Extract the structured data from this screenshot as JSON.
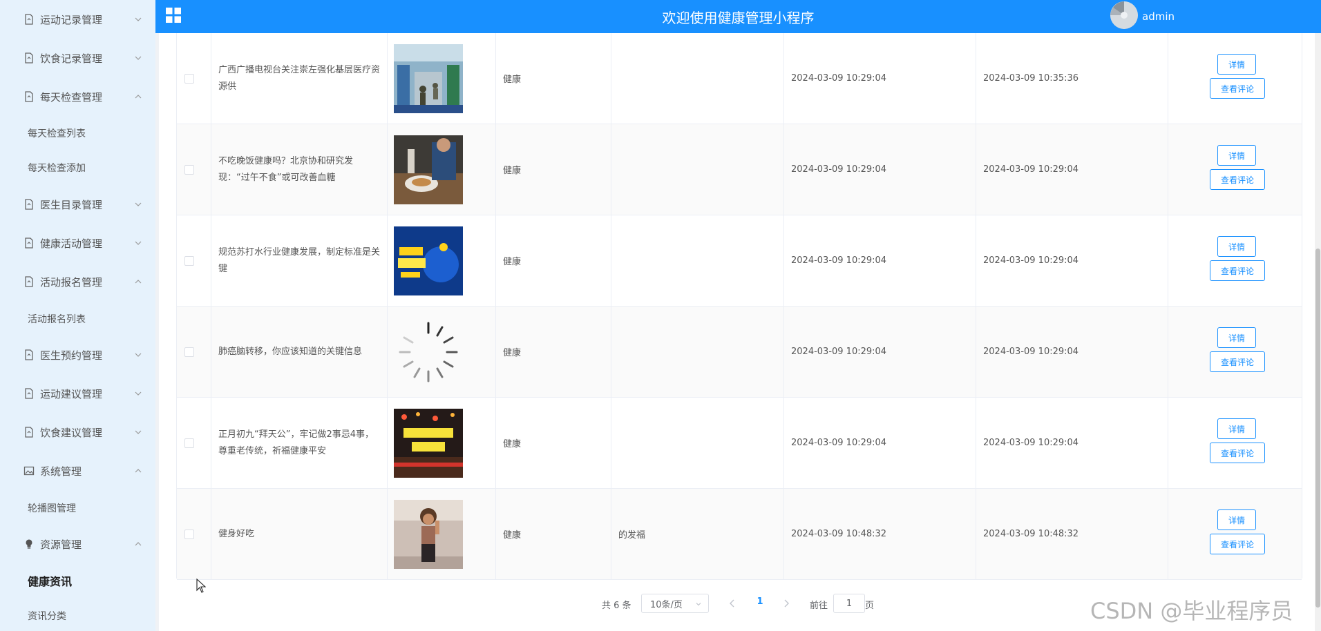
{
  "header": {
    "title": "欢迎使用健康管理小程序",
    "username": "admin"
  },
  "sidebar": {
    "items": [
      {
        "label": "运动记录管理",
        "icon": "document-icon",
        "expanded": false
      },
      {
        "label": "饮食记录管理",
        "icon": "document-icon",
        "expanded": false
      },
      {
        "label": "每天检查管理",
        "icon": "document-icon",
        "expanded": true
      },
      {
        "label": "每天检查列表",
        "sub": true
      },
      {
        "label": "每天检查添加",
        "sub": true
      },
      {
        "label": "医生目录管理",
        "icon": "document-icon",
        "expanded": false
      },
      {
        "label": "健康活动管理",
        "icon": "document-icon",
        "expanded": false
      },
      {
        "label": "活动报名管理",
        "icon": "document-icon",
        "expanded": true
      },
      {
        "label": "活动报名列表",
        "sub": true
      },
      {
        "label": "医生预约管理",
        "icon": "document-icon",
        "expanded": false
      },
      {
        "label": "运动建议管理",
        "icon": "document-icon",
        "expanded": false
      },
      {
        "label": "饮食建议管理",
        "icon": "document-icon",
        "expanded": false
      },
      {
        "label": "系统管理",
        "icon": "picture-icon",
        "expanded": true
      },
      {
        "label": "轮播图管理",
        "sub": true
      },
      {
        "label": "资源管理",
        "icon": "bulb-icon",
        "expanded": true
      },
      {
        "label": "健康资讯",
        "sub": true,
        "active": true
      },
      {
        "label": "资讯分类",
        "sub": true
      }
    ]
  },
  "table": {
    "rows": [
      {
        "title": "广西广播电视台关注崇左强化基层医疗资源供",
        "category": "健康",
        "extra": "",
        "created": "2024-03-09 10:29:04",
        "updated": "2024-03-09 10:35:36",
        "image": "hospital-photo"
      },
      {
        "title": "不吃晚饭健康吗？北京协和研究发现：“过午不食”或可改善血糖",
        "category": "健康",
        "extra": "",
        "created": "2024-03-09 10:29:04",
        "updated": "2024-03-09 10:29:04",
        "image": "dinner-photo"
      },
      {
        "title": "规范苏打水行业健康发展，制定标准是关键",
        "category": "健康",
        "extra": "",
        "created": "2024-03-09 10:29:04",
        "updated": "2024-03-09 10:29:04",
        "image": "poster-photo"
      },
      {
        "title": "肺癌脑转移，你应该知道的关键信息",
        "category": "健康",
        "extra": "",
        "created": "2024-03-09 10:29:04",
        "updated": "2024-03-09 10:29:04",
        "image": "loading-spinner"
      },
      {
        "title": "正月初九“拜天公”，牢记做2事忌4事，尊重老传统，祈福健康平安",
        "category": "健康",
        "extra": "",
        "created": "2024-03-09 10:29:04",
        "updated": "2024-03-09 10:29:04",
        "image": "festival-photo"
      },
      {
        "title": "健身好吃",
        "category": "健康",
        "extra": "的发福",
        "created": "2024-03-09 10:48:32",
        "updated": "2024-03-09 10:48:32",
        "image": "fitness-photo"
      }
    ],
    "detail_label": "详情",
    "comment_label": "查看评论"
  },
  "pagination": {
    "total_text": "共 6 条",
    "page_size": "10条/页",
    "current_page": "1",
    "goto_label": "前往",
    "goto_value": "1",
    "page_unit": "页"
  },
  "watermark": "CSDN @毕业程序员",
  "colors": {
    "primary": "#1890ff",
    "sidebar_bg": "#e6f2fc",
    "text": "#555555"
  }
}
